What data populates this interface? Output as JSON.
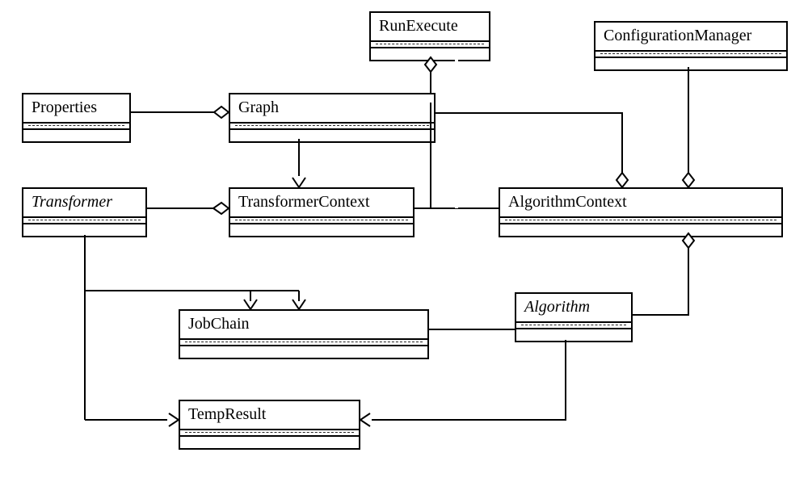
{
  "diagram": {
    "classes": {
      "runExecute": {
        "name": "RunExecute"
      },
      "configurationManager": {
        "name": "ConfigurationManager"
      },
      "properties": {
        "name": "Properties"
      },
      "graph": {
        "name": "Graph"
      },
      "transformer": {
        "name": "Transformer",
        "abstract": true
      },
      "transformerContext": {
        "name": "TransformerContext"
      },
      "algorithmContext": {
        "name": "AlgorithmContext"
      },
      "jobChain": {
        "name": "JobChain"
      },
      "algorithm": {
        "name": "Algorithm",
        "abstract": true
      },
      "tempResult": {
        "name": "TempResult"
      }
    },
    "relationships": [
      {
        "type": "aggregation",
        "whole": "graph",
        "part": "properties"
      },
      {
        "type": "aggregation",
        "whole": "runExecute",
        "part": "graph"
      },
      {
        "type": "aggregation",
        "whole": "algorithmContext",
        "part": "graph"
      },
      {
        "type": "aggregation",
        "whole": "algorithmContext",
        "part": "configurationManager"
      },
      {
        "type": "aggregation",
        "whole": "transformerContext",
        "part": "transformer"
      },
      {
        "type": "aggregation",
        "whole": "algorithmContext",
        "part": "algorithm"
      },
      {
        "type": "association",
        "from": "graph",
        "to": "transformerContext",
        "arrow": true
      },
      {
        "type": "association",
        "from": "transformerContext",
        "to": "algorithmContext"
      },
      {
        "type": "association",
        "from": "runExecute",
        "to": "algorithmContext"
      },
      {
        "type": "association",
        "from": "transformer",
        "to": "jobChain",
        "arrow": true
      },
      {
        "type": "association",
        "from": "algorithm",
        "to": "jobChain",
        "arrow": true
      },
      {
        "type": "association",
        "from": "transformer",
        "to": "tempResult",
        "arrow": true
      },
      {
        "type": "association",
        "from": "algorithm",
        "to": "tempResult",
        "arrow": true
      }
    ]
  }
}
